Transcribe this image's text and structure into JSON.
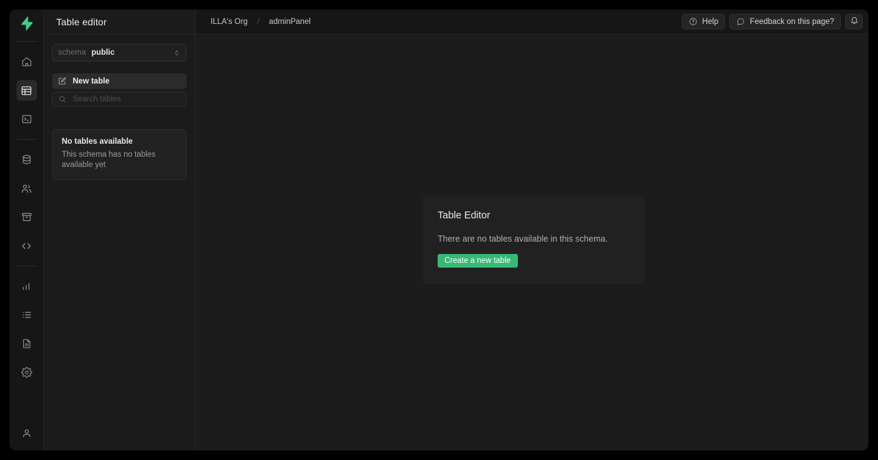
{
  "brand": {
    "logo_icon": "lightning-bolt-logo",
    "accent_color": "#37b877",
    "background_color": "#1c1c1c"
  },
  "rail": {
    "items": [
      {
        "icon": "home-icon",
        "name": "home",
        "active": false
      },
      {
        "icon": "table-icon",
        "name": "table-editor",
        "active": true
      },
      {
        "icon": "sql-terminal-icon",
        "name": "sql-editor",
        "active": false
      },
      {
        "icon": "database-icon",
        "name": "database",
        "active": false
      },
      {
        "icon": "users-icon",
        "name": "authentication",
        "active": false
      },
      {
        "icon": "storage-box-icon",
        "name": "storage",
        "active": false
      },
      {
        "icon": "code-brackets-icon",
        "name": "edge-functions",
        "active": false
      },
      {
        "icon": "bar-chart-icon",
        "name": "reports",
        "active": false
      },
      {
        "icon": "list-icon",
        "name": "logs",
        "active": false
      },
      {
        "icon": "document-icon",
        "name": "api-docs",
        "active": false
      },
      {
        "icon": "gear-icon",
        "name": "settings",
        "active": false
      }
    ],
    "account_icon": "user-icon"
  },
  "panel": {
    "title": "Table editor",
    "schema": {
      "label": "schema",
      "value": "public",
      "caret_icon": "chevron-up-down-icon"
    },
    "new_table": {
      "label": "New table",
      "icon": "new-table-icon"
    },
    "search": {
      "placeholder": "Search tables",
      "value": "",
      "icon": "search-icon"
    },
    "empty_card": {
      "title": "No tables available",
      "description": "This schema has no tables available yet"
    }
  },
  "topbar": {
    "breadcrumb": {
      "org": "ILLA's Org",
      "separator": "/",
      "project": "adminPanel"
    },
    "help_button": {
      "label": "Help",
      "icon": "question-circle-icon"
    },
    "feedback_button": {
      "label": "Feedback on this page?",
      "icon": "chat-bubble-icon"
    },
    "notifications_button": {
      "icon": "bell-icon"
    }
  },
  "editor_card": {
    "title": "Table Editor",
    "description": "There are no tables available in this schema.",
    "create_button": "Create a new table"
  }
}
